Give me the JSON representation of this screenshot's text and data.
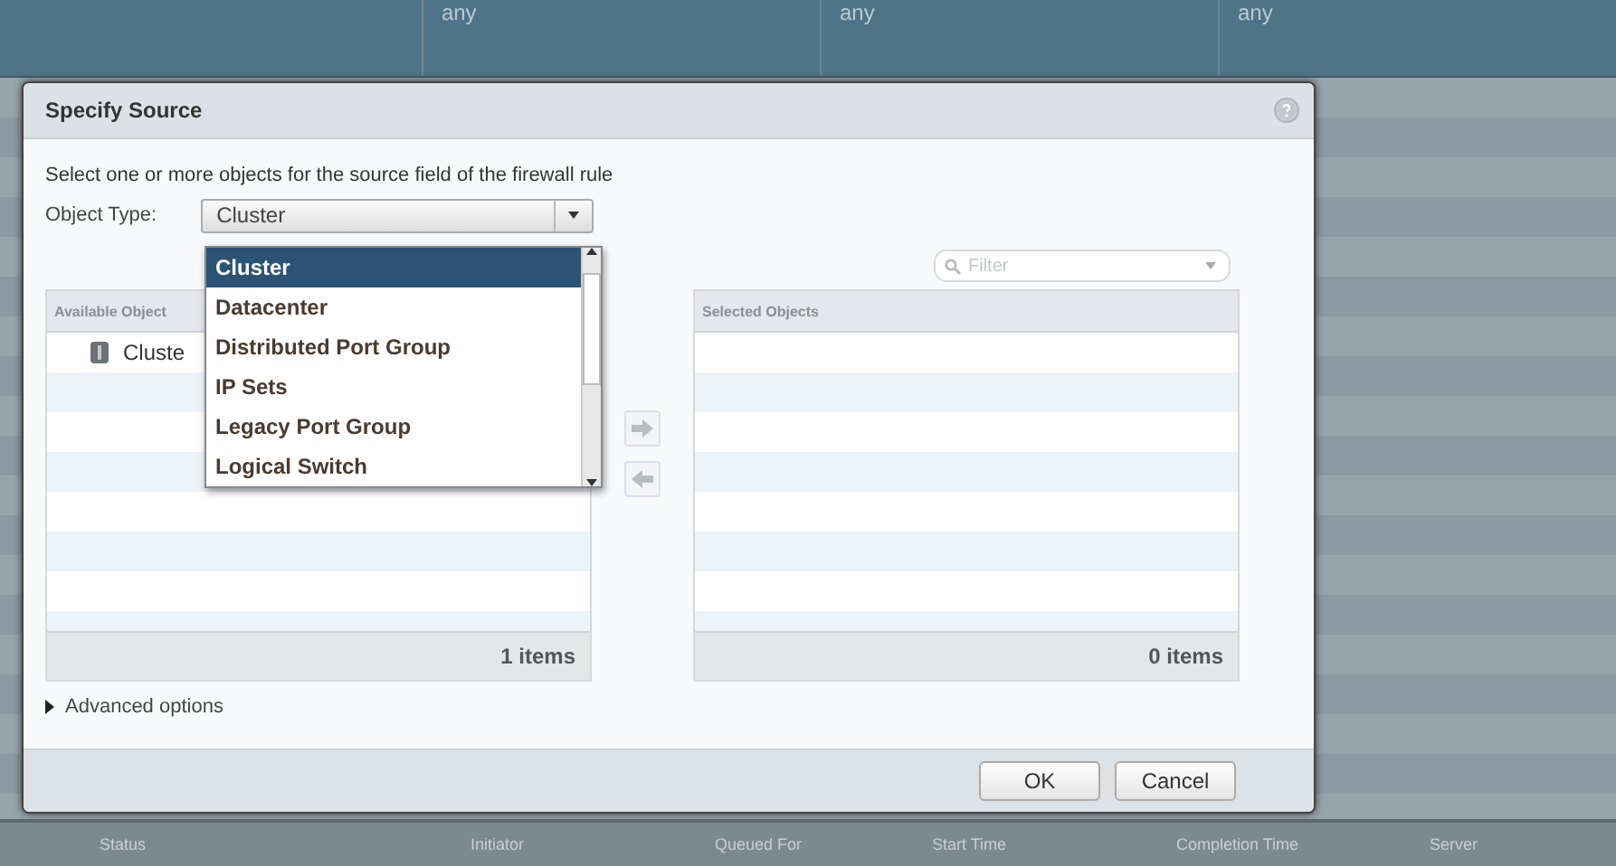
{
  "background_table": {
    "top_row": [
      "any",
      "any",
      "any"
    ],
    "bottom_columns": [
      "Status",
      "Initiator",
      "Queued For",
      "Start Time",
      "Completion Time",
      "Server"
    ]
  },
  "dialog": {
    "title": "Specify Source",
    "instruction": "Select one or more objects for the source field of the firewall rule",
    "object_type": {
      "label": "Object Type:",
      "value": "Cluster",
      "expanded": true,
      "options": [
        {
          "label": "Cluster",
          "selected": true
        },
        {
          "label": "Datacenter",
          "selected": false
        },
        {
          "label": "Distributed Port Group",
          "selected": false
        },
        {
          "label": "IP Sets",
          "selected": false
        },
        {
          "label": "Legacy Port Group",
          "selected": false
        },
        {
          "label": "Logical Switch",
          "selected": false
        }
      ]
    },
    "filter": {
      "placeholder": "Filter"
    },
    "available": {
      "header": "Available Object",
      "items": [
        "Cluste"
      ],
      "count": "1 items"
    },
    "selected_objects": {
      "header": "Selected Objects",
      "count": "0 items"
    },
    "advanced": {
      "label": "Advanced options",
      "expanded": false
    },
    "buttons": [
      "OK",
      "Cancel"
    ]
  }
}
